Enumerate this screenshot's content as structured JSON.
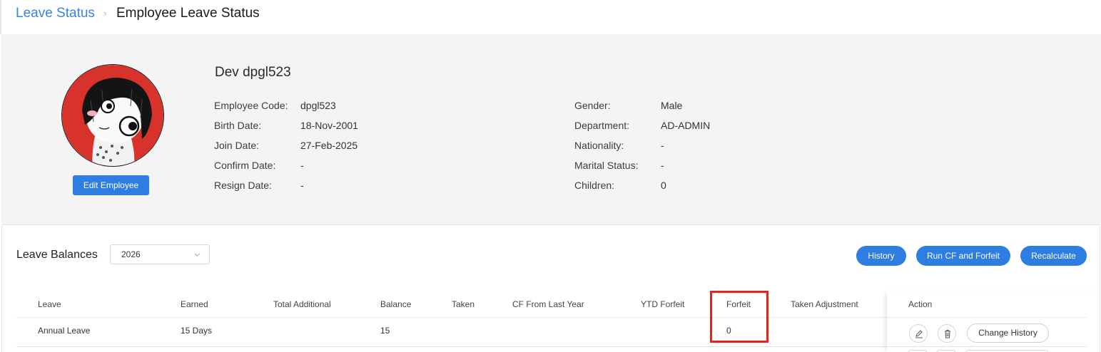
{
  "breadcrumb": {
    "parent": "Leave Status",
    "separator": "›",
    "current": "Employee Leave Status"
  },
  "employee": {
    "name": "Dev dpgl523",
    "edit_label": "Edit Employee",
    "left_fields": [
      {
        "label": "Employee Code:",
        "value": "dpgl523"
      },
      {
        "label": "Birth Date:",
        "value": "18-Nov-2001"
      },
      {
        "label": "Join Date:",
        "value": "27-Feb-2025"
      },
      {
        "label": "Confirm Date:",
        "value": "-"
      },
      {
        "label": "Resign Date:",
        "value": "-"
      }
    ],
    "right_fields": [
      {
        "label": "Gender:",
        "value": "Male"
      },
      {
        "label": "Department:",
        "value": "AD-ADMIN"
      },
      {
        "label": "Nationality:",
        "value": "-"
      },
      {
        "label": "Marital Status:",
        "value": "-"
      },
      {
        "label": "Children:",
        "value": "0"
      }
    ]
  },
  "balances": {
    "title": "Leave Balances",
    "year": "2026",
    "buttons": {
      "history": "History",
      "run_cf": "Run CF and Forfeit",
      "recalculate": "Recalculate"
    },
    "columns": [
      "Leave",
      "Earned",
      "Total Additional",
      "Balance",
      "Taken",
      "CF From Last Year",
      "YTD Forfeit",
      "Forfeit",
      "Taken Adjustment",
      "Action"
    ],
    "rows": [
      {
        "leave": "Annual Leave",
        "earned": "15 Days",
        "total_additional": "",
        "balance": "15",
        "taken": "",
        "cf_from_last_year": "",
        "ytd_forfeit": "",
        "forfeit": "0",
        "taken_adjustment": "",
        "change_history": "Change History"
      }
    ]
  },
  "colors": {
    "accent": "#2e7de1",
    "link": "#3b82e6",
    "highlight": "#e8231b",
    "panel": "#f4f4f4"
  },
  "icons": {
    "edit": "pencil-icon",
    "delete": "trash-icon",
    "select": "chevron-down-icon"
  }
}
